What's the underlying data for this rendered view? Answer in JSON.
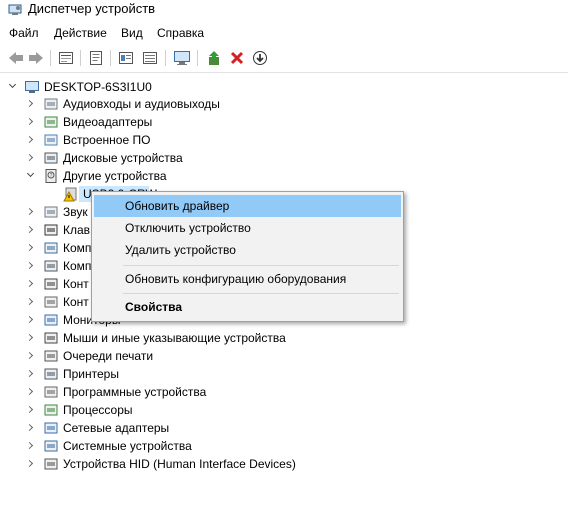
{
  "window": {
    "title": "Диспетчер устройств"
  },
  "menu": [
    "Файл",
    "Действие",
    "Вид",
    "Справка"
  ],
  "toolbar": {
    "icons": [
      "back-icon",
      "forward-icon",
      "properties-icon",
      "help-icon",
      "view-icon",
      "scan-hardware-icon",
      "update-driver-icon",
      "uninstall-icon",
      "disable-icon"
    ]
  },
  "tree": {
    "root": "DESKTOP-6S3I1U0",
    "items": [
      "Аудиовходы и аудиовыходы",
      "Видеоадаптеры",
      "Встроенное ПО",
      "Дисковые устройства",
      "Другие устройства",
      "USB2.0-CRW",
      "Звуковые, игровые и видеоустройства",
      "Клавиатуры",
      "Компьютер",
      "Компоненты программного обеспечения",
      "Контроллеры USB",
      "Контроллеры запоминающих устройств",
      "Мониторы",
      "Мыши и иные указывающие устройства",
      "Очереди печати",
      "Принтеры",
      "Программные устройства",
      "Процессоры",
      "Сетевые адаптеры",
      "Системные устройства",
      "Устройства HID (Human Interface Devices)"
    ],
    "partial": {
      "zvuk": "Звук",
      "klav": "Клав",
      "komp1": "Комп",
      "komp2": "Комп",
      "kont1": "Конт",
      "kont2": "Конт",
      "usb_child": "USB2.0-CRW"
    }
  },
  "context_menu": {
    "update_driver": "Обновить драйвер",
    "disable_device": "Отключить устройство",
    "uninstall_device": "Удалить устройство",
    "scan_hardware": "Обновить конфигурацию оборудования",
    "properties": "Свойства"
  },
  "colors": {
    "selection": "#cce8ff",
    "menu_highlight": "#91c9f7",
    "menu_bg": "#f2f2f2",
    "uninstall_red": "#d42020",
    "update_green": "#2e9e3a"
  }
}
